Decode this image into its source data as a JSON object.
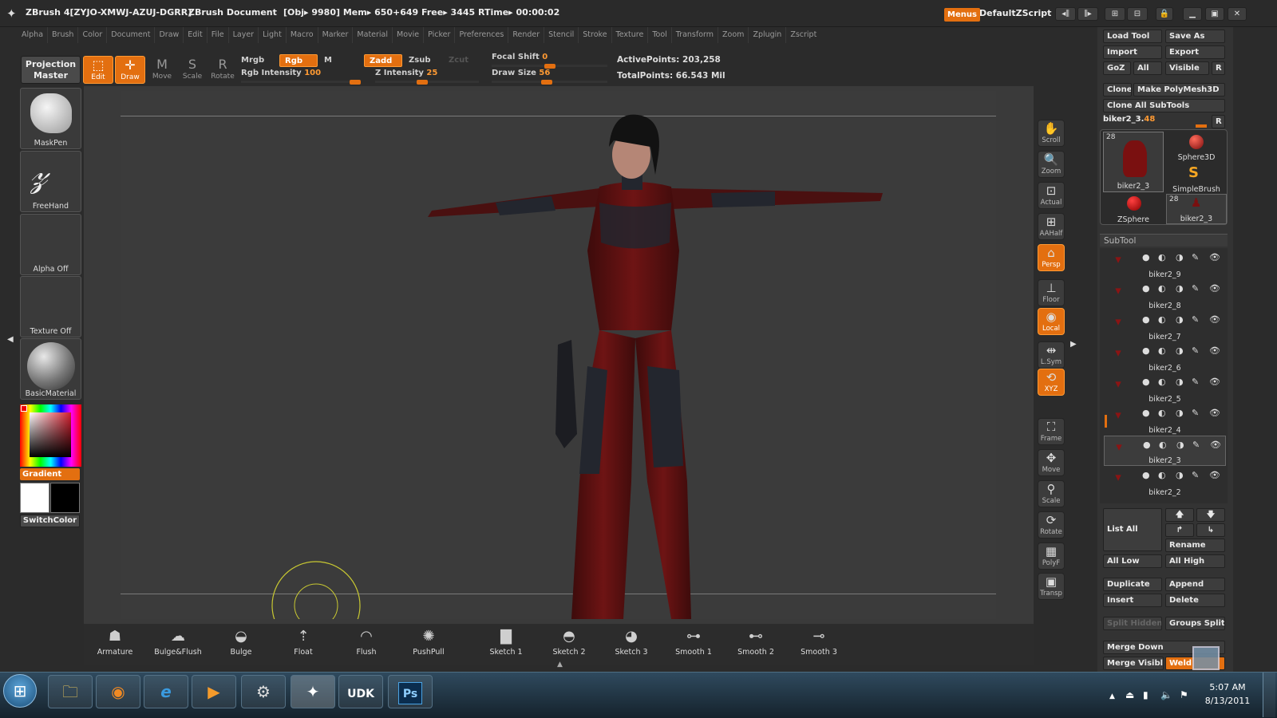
{
  "window": {
    "title": "ZBrush 4[ZYJO-XMWJ-AZUJ-DGRR]",
    "doc": "ZBrush Document",
    "stats": "[Obj▸ 9980] Mem▸ 650+649  Free▸ 3445  RTime▸ 00:00:02",
    "menus_btn": "Menus",
    "script": "DefaultZScript"
  },
  "menubar": [
    "Alpha",
    "Brush",
    "Color",
    "Document",
    "Draw",
    "Edit",
    "File",
    "Layer",
    "Light",
    "Macro",
    "Marker",
    "Material",
    "Movie",
    "Picker",
    "Preferences",
    "Render",
    "Stencil",
    "Stroke",
    "Texture",
    "Tool",
    "Transform",
    "Zoom",
    "Zplugin",
    "Zscript"
  ],
  "toolbar": {
    "projection_master": "Projection Master",
    "edit": "Edit",
    "draw": "Draw",
    "move": "Move",
    "scale": "Scale",
    "rotate": "Rotate",
    "mrgb": "Mrgb",
    "rgb": "Rgb",
    "m": "M",
    "zadd": "Zadd",
    "zsub": "Zsub",
    "zcut": "Zcut",
    "rgb_intensity_label": "Rgb Intensity",
    "rgb_intensity": "100",
    "z_intensity_label": "Z Intensity",
    "z_intensity": "25",
    "focal_shift_label": "Focal Shift",
    "focal_shift": "0",
    "draw_size_label": "Draw Size",
    "draw_size": "56",
    "active_points": "ActivePoints: 203,258",
    "total_points": "TotalPoints: 66.543 Mil"
  },
  "left_shelf": {
    "brush": "MaskPen",
    "stroke": "FreeHand",
    "alpha": "Alpha Off",
    "texture": "Texture Off",
    "material": "BasicMaterial",
    "gradient": "Gradient",
    "switch_color": "SwitchColor",
    "main_color": "#ffffff",
    "secondary_color": "#000000"
  },
  "right_nav": [
    {
      "label": "Scroll",
      "icon": "hand-icon"
    },
    {
      "label": "Zoom",
      "icon": "zoom-icon"
    },
    {
      "label": "Actual",
      "icon": "actual-icon"
    },
    {
      "label": "AAHalf",
      "icon": "aahalf-icon"
    },
    {
      "label": "Persp",
      "icon": "persp-icon",
      "active": true
    },
    {
      "label": "Floor",
      "icon": "floor-icon"
    },
    {
      "label": "Local",
      "icon": "local-icon",
      "active": true
    },
    {
      "label": "L.Sym",
      "icon": "lsym-icon"
    },
    {
      "label": "XYZ",
      "icon": "xyz-icon",
      "active": true
    },
    {
      "label": "Frame",
      "icon": "frame-icon"
    },
    {
      "label": "Move",
      "icon": "move-icon"
    },
    {
      "label": "Scale",
      "icon": "scale-icon"
    },
    {
      "label": "Rotate",
      "icon": "rotate-icon"
    },
    {
      "label": "PolyF",
      "icon": "polyf-icon"
    },
    {
      "label": "Transp",
      "icon": "transp-icon"
    }
  ],
  "bottom_brushes": [
    "Armature",
    "Bulge&Flush",
    "Bulge",
    "Float",
    "Flush",
    "PushPull",
    "Sketch 1",
    "Sketch 2",
    "Sketch 3",
    "Smooth 1",
    "Smooth 2",
    "Smooth 3"
  ],
  "tool_panel": {
    "load_tool": "Load Tool",
    "save_as": "Save As",
    "import": "Import",
    "export": "Export",
    "goz": "GoZ",
    "all": "All",
    "visible": "Visible",
    "r": "R",
    "clone": "Clone",
    "make_polymesh": "Make PolyMesh3D",
    "clone_all": "Clone All SubTools",
    "current_tool_label": "biker2_3.",
    "current_tool_value": "48",
    "thumbs": [
      {
        "label": "biker2_3",
        "count": "28"
      },
      {
        "label": "Sphere3D"
      },
      {
        "label": "SimpleBrush"
      },
      {
        "label": "ZSphere"
      },
      {
        "label": "biker2_3",
        "count": "28"
      }
    ]
  },
  "subtool": {
    "header": "SubTool",
    "items": [
      "biker2_9",
      "biker2_8",
      "biker2_7",
      "biker2_6",
      "biker2_5",
      "biker2_4",
      "biker2_3",
      "biker2_2"
    ],
    "list_all": "List All",
    "rename": "Rename",
    "all_low": "All Low",
    "all_high": "All High",
    "duplicate": "Duplicate",
    "append": "Append",
    "insert": "Insert",
    "delete": "Delete",
    "split_hidden": "Split Hidden",
    "groups_split": "Groups Split",
    "merge_down": "Merge Down",
    "merge_visible": "Merge Visible",
    "weld": "Weld"
  },
  "taskbar": {
    "apps": [
      "Explorer",
      "Firefox",
      "Internet Explorer",
      "Media Player",
      "Steam",
      "ZBrush",
      "UDK",
      "Photoshop"
    ],
    "udk": "UDK",
    "ps": "Ps",
    "time": "5:07 AM",
    "date": "8/13/2011"
  },
  "colors": {
    "accent": "#e36f10",
    "suit_red": "#6e1414",
    "suit_dark": "#23262e",
    "bg": "#2b2b2b"
  }
}
